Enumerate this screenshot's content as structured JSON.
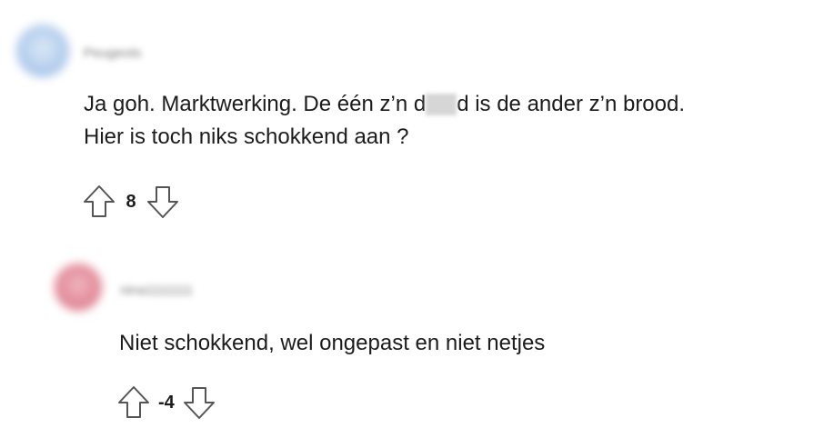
{
  "comments": [
    {
      "author": "Peugeots",
      "avatar_color": "#bcd3ef",
      "body_before": "Ja goh. Marktwerking. De één z’n d",
      "body_after": "d is de ander z’n brood.",
      "body_line2": "Hier is toch niks schokkend aan ?",
      "score": "8",
      "upvote_icon": "arrow-up-icon",
      "downvote_icon": "arrow-down-icon"
    },
    {
      "author": "nina1111111",
      "avatar_color": "#e38c9b",
      "body": "Niet schokkend, wel ongepast en niet netjes",
      "score": "-4",
      "upvote_icon": "arrow-up-icon",
      "downvote_icon": "arrow-down-icon"
    }
  ],
  "colors": {
    "text": "#1c1c1c",
    "muted": "#7c7c7c",
    "icon": "#555555"
  }
}
